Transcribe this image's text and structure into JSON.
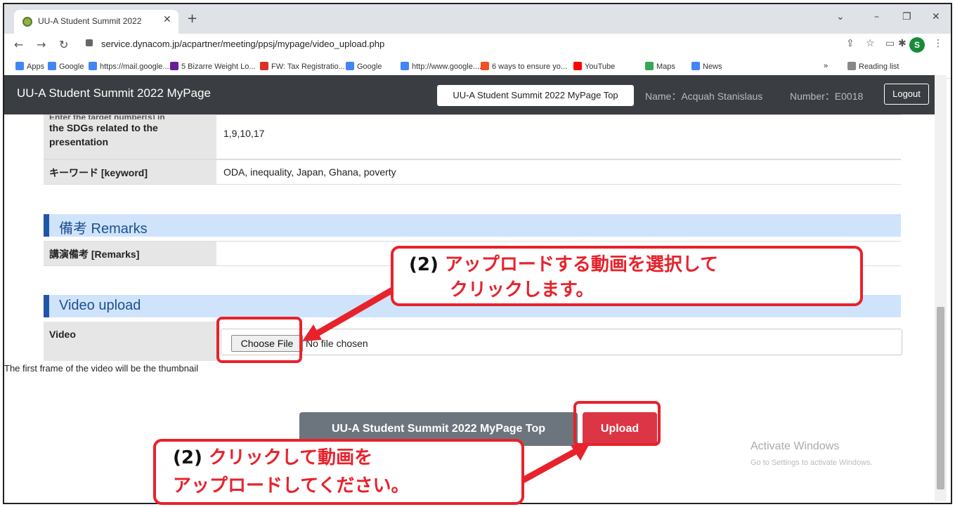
{
  "browser": {
    "tab_title": "UU-A Student Summit 2022",
    "url": "service.dynacom.jp/acpartner/meeting/ppsj/mypage/video_upload.php",
    "profile_initial": "S",
    "bookmarks": [
      {
        "label": "Apps",
        "color": "#4285f4"
      },
      {
        "label": "Google",
        "color": "#4285f4"
      },
      {
        "label": "https://mail.google....",
        "color": "#4285f4"
      },
      {
        "label": "5 Bizarre Weight Lo...",
        "color": "#6a1b9a"
      },
      {
        "label": "FW: Tax Registratio...",
        "color": "#d93025"
      },
      {
        "label": "Google",
        "color": "#4285f4"
      },
      {
        "label": "http://www.google....",
        "color": "#4285f4"
      },
      {
        "label": "6 ways to ensure yo...",
        "color": "#f25022"
      },
      {
        "label": "YouTube",
        "color": "#ff0000"
      },
      {
        "label": "Maps",
        "color": "#34a853"
      },
      {
        "label": "News",
        "color": "#4285f4"
      }
    ],
    "more": "»",
    "reading_list": "Reading list"
  },
  "header": {
    "brand": "UU-A Student Summit 2022 MyPage",
    "top_button": "UU-A Student Summit 2022 MyPage Top",
    "name": "Name：Acquah Stanislaus",
    "number": "Number：E0018",
    "logout": "Logout"
  },
  "rows": {
    "sdg_label_cut": "Enter the target number(s) in",
    "sdg_label_1": "the SDGs related to the",
    "sdg_label_2": "presentation",
    "sdg_value": "1,9,10,17",
    "keyword_label": "キーワード [keyword]",
    "keyword_value": "ODA, inequality, Japan, Ghana, poverty"
  },
  "remarks": {
    "title": "備考 Remarks",
    "label": "講演備考 [Remarks]"
  },
  "video": {
    "title": "Video upload",
    "label": "Video",
    "choose": "Choose File",
    "nofile": "No file chosen",
    "note": "The first frame of the video will be the thumbnail"
  },
  "footer": {
    "top_button": "UU-A Student Summit 2022 MyPage Top",
    "upload": "Upload"
  },
  "activate": {
    "line1": "Activate Windows",
    "line2": "Go to Settings to activate Windows."
  },
  "annotations": {
    "a1_prefix": "(2)",
    "a1_line1": "アップロードする動画を選択して",
    "a1_line2": "クリックします。",
    "a2_prefix": "(2)",
    "a2_line1": "クリックして動画を",
    "a2_line2": "アップロードしてください。"
  },
  "colors": {
    "accent": "#e8222c",
    "section": "#cfe4fb",
    "upload": "#dc3545"
  }
}
